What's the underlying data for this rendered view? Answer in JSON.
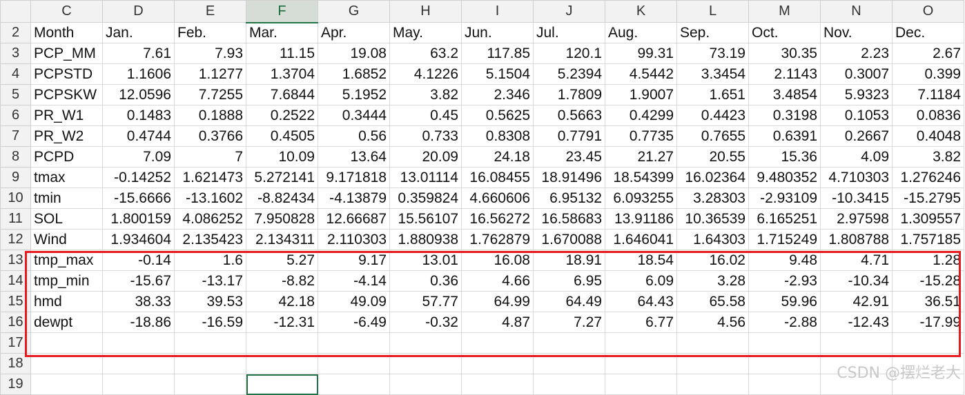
{
  "columns": [
    "C",
    "D",
    "E",
    "F",
    "G",
    "H",
    "I",
    "J",
    "K",
    "L",
    "M",
    "N",
    "O"
  ],
  "selected_column": "F",
  "rows": [
    {
      "n": "2",
      "cells": [
        "Month",
        "Jan.",
        "Feb.",
        "Mar.",
        "Apr.",
        "May.",
        "Jun.",
        "Jul.",
        "Aug.",
        "Sep.",
        "Oct.",
        "Nov.",
        "Dec."
      ]
    },
    {
      "n": "3",
      "cells": [
        "PCP_MM",
        "7.61",
        "7.93",
        "11.15",
        "19.08",
        "63.2",
        "117.85",
        "120.1",
        "99.31",
        "73.19",
        "30.35",
        "2.23",
        "2.67"
      ]
    },
    {
      "n": "4",
      "cells": [
        "PCPSTD",
        "1.1606",
        "1.1277",
        "1.3704",
        "1.6852",
        "4.1226",
        "5.1504",
        "5.2394",
        "4.5442",
        "3.3454",
        "2.1143",
        "0.3007",
        "0.399"
      ]
    },
    {
      "n": "5",
      "cells": [
        "PCPSKW",
        "12.0596",
        "7.7255",
        "7.6844",
        "5.1952",
        "3.82",
        "2.346",
        "1.7809",
        "1.9007",
        "1.651",
        "3.4854",
        "5.9323",
        "7.1184"
      ]
    },
    {
      "n": "6",
      "cells": [
        "PR_W1",
        "0.1483",
        "0.1888",
        "0.2522",
        "0.3444",
        "0.45",
        "0.5625",
        "0.5663",
        "0.4299",
        "0.4423",
        "0.3198",
        "0.1053",
        "0.0836"
      ]
    },
    {
      "n": "7",
      "cells": [
        "PR_W2",
        "0.4744",
        "0.3766",
        "0.4505",
        "0.56",
        "0.733",
        "0.8308",
        "0.7791",
        "0.7735",
        "0.7655",
        "0.6391",
        "0.2667",
        "0.4048"
      ]
    },
    {
      "n": "8",
      "cells": [
        "PCPD",
        "7.09",
        "7",
        "10.09",
        "13.64",
        "20.09",
        "24.18",
        "23.45",
        "21.27",
        "20.55",
        "15.36",
        "4.09",
        "3.82"
      ]
    },
    {
      "n": "9",
      "cells": [
        "tmax",
        "-0.14252",
        "1.621473",
        "5.272141",
        "9.171818",
        "13.01114",
        "16.08455",
        "18.91496",
        "18.54399",
        "16.02364",
        "9.480352",
        "4.710303",
        "1.276246"
      ]
    },
    {
      "n": "10",
      "cells": [
        "tmin",
        "-15.6666",
        "-13.1602",
        "-8.82434",
        "-4.13879",
        "0.359824",
        "4.660606",
        "6.95132",
        "6.093255",
        "3.28303",
        "-2.93109",
        "-10.3415",
        "-15.2795"
      ]
    },
    {
      "n": "11",
      "cells": [
        "SOL",
        "1.800159",
        "4.086252",
        "7.950828",
        "12.66687",
        "15.56107",
        "16.56272",
        "16.58683",
        "13.91186",
        "10.36539",
        "6.165251",
        "2.97598",
        "1.309557"
      ]
    },
    {
      "n": "12",
      "cells": [
        "Wind",
        "1.934604",
        "2.135423",
        "2.134311",
        "2.110303",
        "1.880938",
        "1.762879",
        "1.670088",
        "1.646041",
        "1.64303",
        "1.715249",
        "1.808788",
        "1.757185"
      ]
    },
    {
      "n": "13",
      "cells": [
        "tmp_max",
        "-0.14",
        "1.6",
        "5.27",
        "9.17",
        "13.01",
        "16.08",
        "18.91",
        "18.54",
        "16.02",
        "9.48",
        "4.71",
        "1.28"
      ]
    },
    {
      "n": "14",
      "cells": [
        "tmp_min",
        "-15.67",
        "-13.17",
        "-8.82",
        "-4.14",
        "0.36",
        "4.66",
        "6.95",
        "6.09",
        "3.28",
        "-2.93",
        "-10.34",
        "-15.28"
      ]
    },
    {
      "n": "15",
      "cells": [
        "hmd",
        "38.33",
        "39.53",
        "42.18",
        "49.09",
        "57.77",
        "64.99",
        "64.49",
        "64.43",
        "65.58",
        "59.96",
        "42.91",
        "36.51"
      ]
    },
    {
      "n": "16",
      "cells": [
        "dewpt",
        "-18.86",
        "-16.59",
        "-12.31",
        "-6.49",
        "-0.32",
        "4.87",
        "7.27",
        "6.77",
        "4.56",
        "-2.88",
        "-12.43",
        "-17.99"
      ]
    },
    {
      "n": "17",
      "cells": [
        "",
        "",
        "",
        "",
        "",
        "",
        "",
        "",
        "",
        "",
        "",
        "",
        ""
      ]
    },
    {
      "n": "18",
      "cells": [
        "",
        "",
        "",
        "",
        "",
        "",
        "",
        "",
        "",
        "",
        "",
        "",
        ""
      ]
    },
    {
      "n": "19",
      "cells": [
        "",
        "",
        "",
        "",
        "",
        "",
        "",
        "",
        "",
        "",
        "",
        "",
        ""
      ]
    }
  ],
  "active_cell": {
    "row": "19",
    "column": "F"
  },
  "watermark": "CSDN @摆烂老大",
  "colors": {
    "highlight_border": "#e8191e",
    "selection": "#217346"
  }
}
